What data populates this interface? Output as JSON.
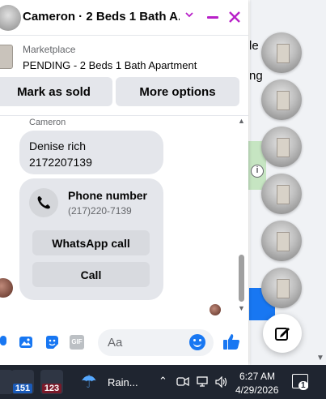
{
  "header": {
    "title": "Cameron · 2 Beds 1 Bath A...",
    "chevron_icon": "chevron-down-icon",
    "minimize_icon": "minimize-icon",
    "close_icon": "close-icon"
  },
  "marketplace": {
    "label": "Marketplace",
    "status": "PENDING - 2 Beds 1 Bath Apartment"
  },
  "actions": {
    "mark_sold": "Mark as sold",
    "more_options": "More options"
  },
  "messages": {
    "sender": "Cameron",
    "text_lines": [
      "Denise rich",
      "2172207139"
    ],
    "phone_card": {
      "title": "Phone number",
      "number": "(217)220-7139",
      "whatsapp_label": "WhatsApp call",
      "call_label": "Call"
    }
  },
  "composer": {
    "placeholder": "Aa",
    "icons": [
      "mic-icon",
      "image-icon",
      "sticker-icon",
      "gif-icon",
      "emoji-icon",
      "like-icon"
    ],
    "gif_label": "GIF"
  },
  "background": {
    "partial_text": [
      "le",
      "ng"
    ],
    "info_glyph": "i"
  },
  "taskbar": {
    "badge_1": "151",
    "badge_2": "123",
    "weather": "Rain...",
    "time": "6:27 AM",
    "date": "4/29/2026",
    "notification_count": "1"
  },
  "colors": {
    "accent_purple": "#b820c8",
    "messenger_blue": "#1877f2",
    "bubble_gray": "#e4e6eb",
    "taskbar": "#1f2530"
  }
}
